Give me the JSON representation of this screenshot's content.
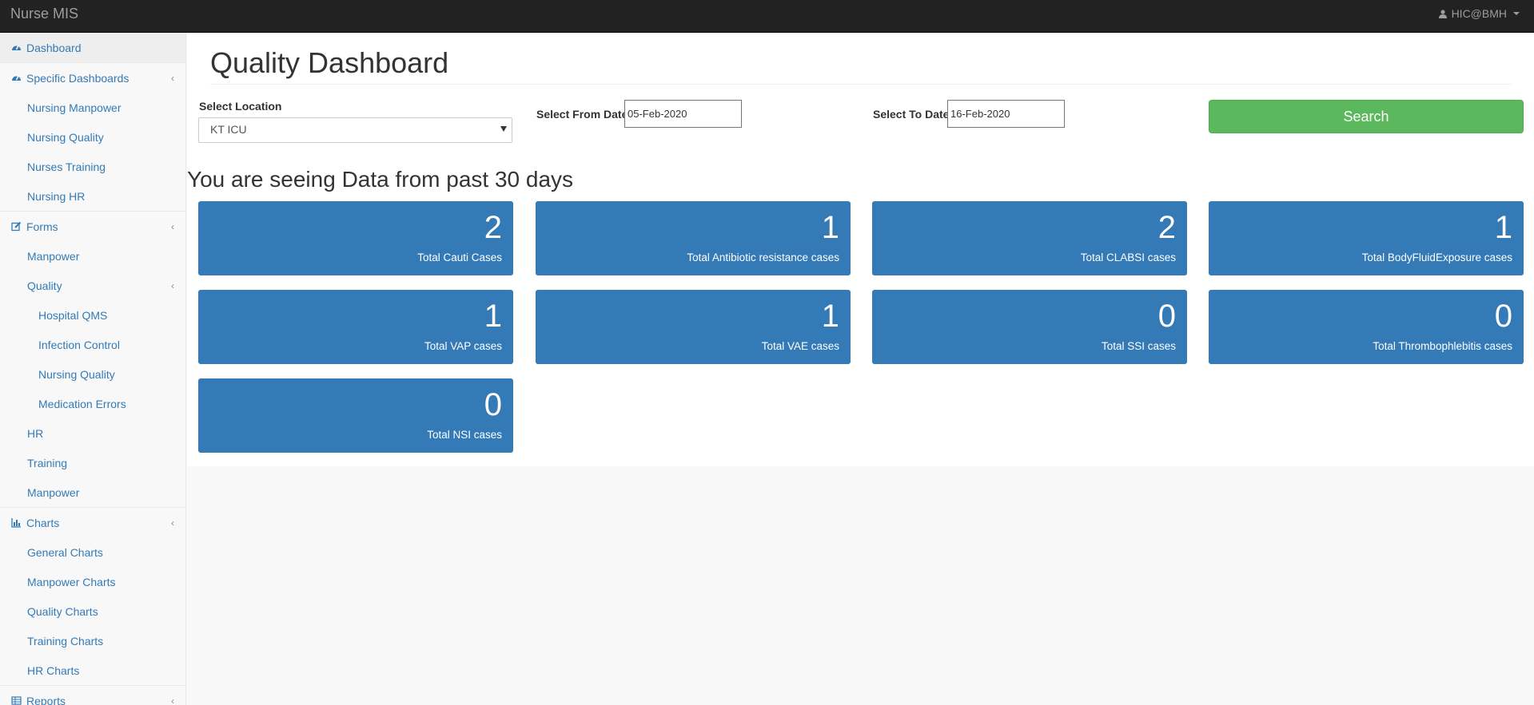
{
  "header": {
    "brand": "Nurse MIS",
    "user": "HIC@BMH"
  },
  "sidebar": {
    "items": [
      {
        "label": "Dashboard"
      },
      {
        "label": "Specific Dashboards"
      },
      {
        "label": "Nursing Manpower"
      },
      {
        "label": "Nursing Quality"
      },
      {
        "label": "Nurses Training"
      },
      {
        "label": "Nursing HR"
      },
      {
        "label": "Forms"
      },
      {
        "label": "Manpower"
      },
      {
        "label": "Quality"
      },
      {
        "label": "Hospital QMS"
      },
      {
        "label": "Infection Control"
      },
      {
        "label": "Nursing Quality"
      },
      {
        "label": "Medication Errors"
      },
      {
        "label": "HR"
      },
      {
        "label": "Training"
      },
      {
        "label": "Manpower"
      },
      {
        "label": "Charts"
      },
      {
        "label": "General Charts"
      },
      {
        "label": "Manpower Charts"
      },
      {
        "label": "Quality Charts"
      },
      {
        "label": "Training Charts"
      },
      {
        "label": "HR Charts"
      },
      {
        "label": "Reports"
      }
    ]
  },
  "main": {
    "title": "Quality Dashboard",
    "filters": {
      "location_label": "Select Location",
      "location_value": "KT ICU",
      "from_label": "Select From Date:",
      "from_value": "05-Feb-2020",
      "to_label": "Select To Date:",
      "to_value": "16-Feb-2020",
      "search_label": "Search"
    },
    "subtitle": "You are seeing Data from past 30 days",
    "tiles": [
      {
        "value": "2",
        "label": "Total Cauti Cases"
      },
      {
        "value": "1",
        "label": "Total Antibiotic resistance cases"
      },
      {
        "value": "2",
        "label": "Total CLABSI cases"
      },
      {
        "value": "1",
        "label": "Total BodyFluidExposure cases"
      },
      {
        "value": "1",
        "label": "Total VAP cases"
      },
      {
        "value": "1",
        "label": "Total VAE cases"
      },
      {
        "value": "0",
        "label": "Total SSI cases"
      },
      {
        "value": "0",
        "label": "Total Thrombophlebitis cases"
      },
      {
        "value": "0",
        "label": "Total NSI cases"
      }
    ]
  },
  "colors": {
    "navbar": "#222222",
    "link": "#337ab7",
    "tile": "#337ab7",
    "search_button": "#5cb85c"
  }
}
